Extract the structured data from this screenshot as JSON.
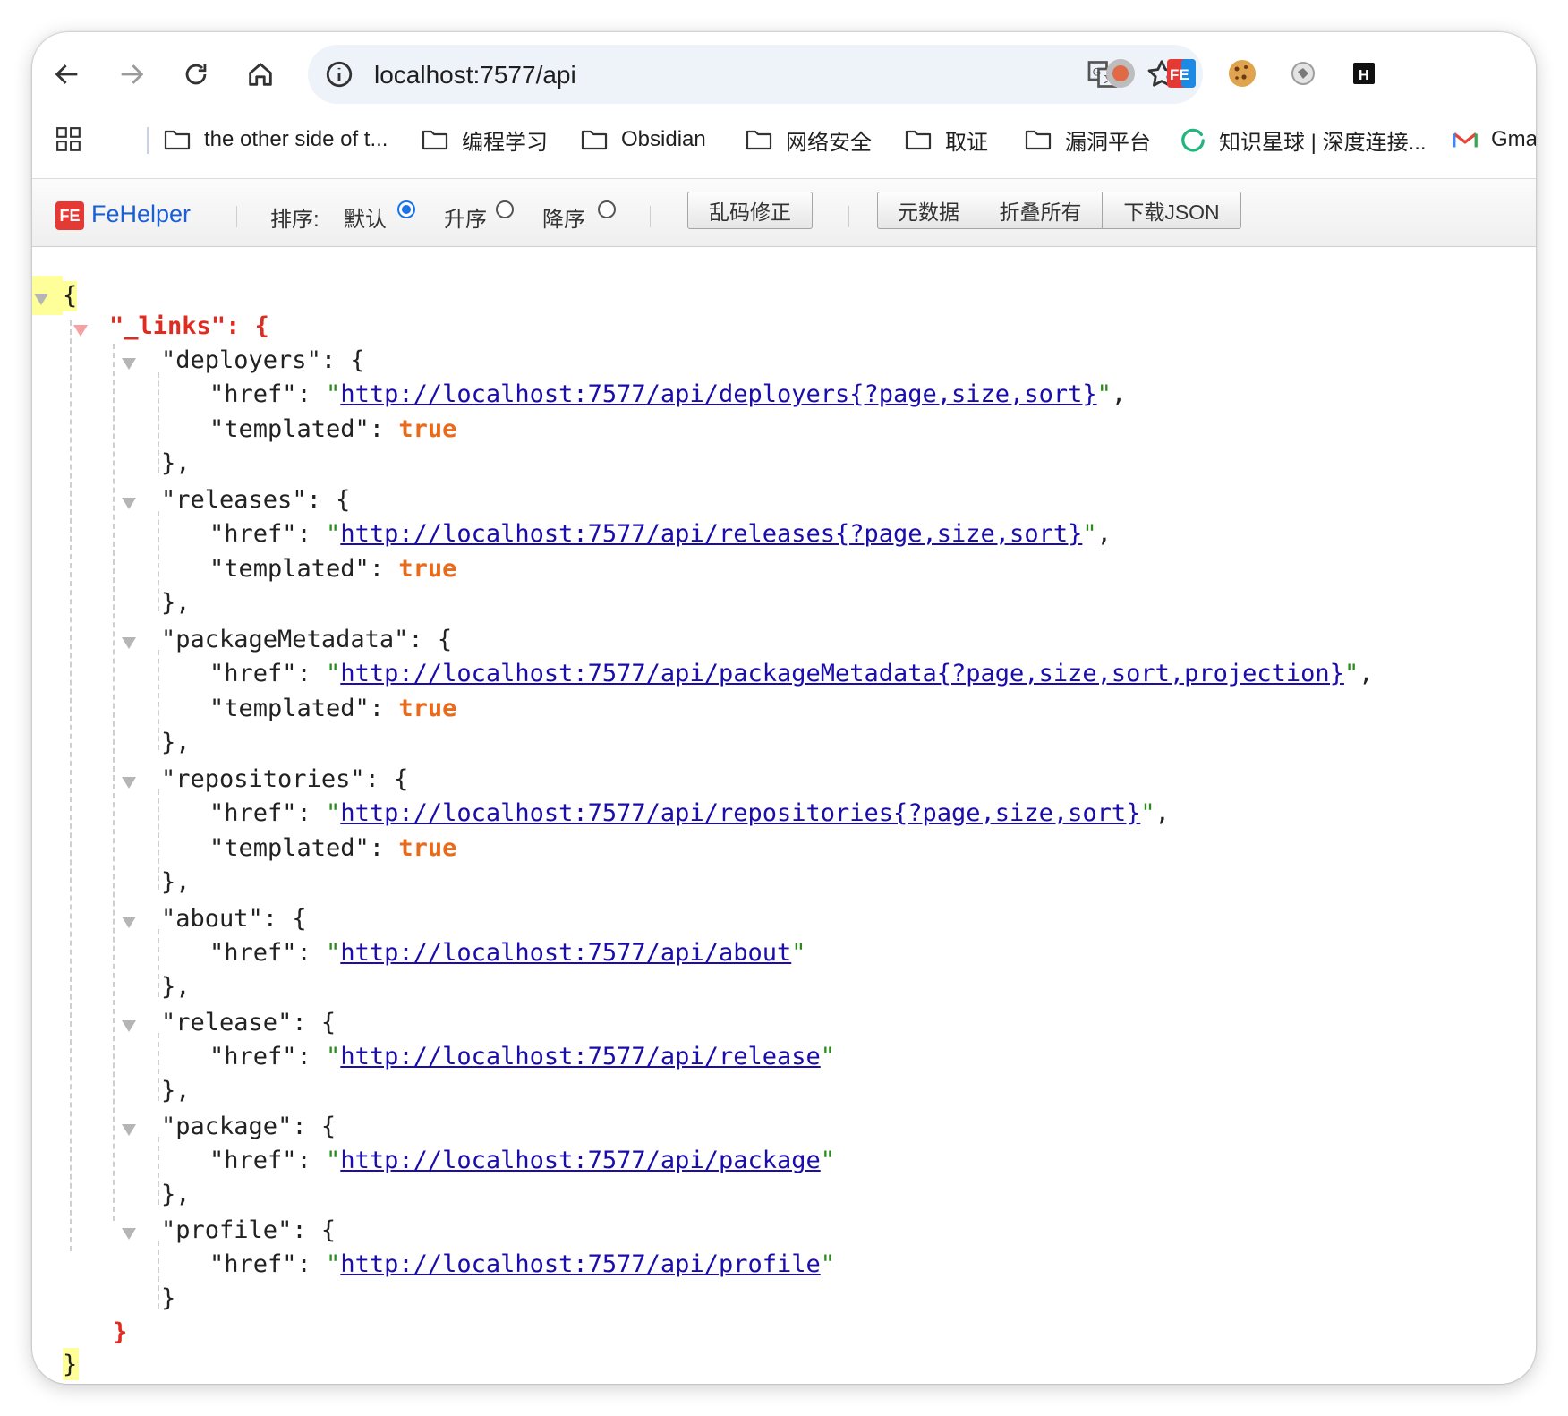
{
  "browser": {
    "url": "localhost:7577/api",
    "bookmarks": [
      {
        "label": "the other side of t...",
        "icon": "folder-icon"
      },
      {
        "label": "编程学习",
        "icon": "folder-icon"
      },
      {
        "label": "Obsidian",
        "icon": "folder-icon"
      },
      {
        "label": "网络安全",
        "icon": "folder-icon"
      },
      {
        "label": "取证",
        "icon": "folder-icon"
      },
      {
        "label": "漏洞平台",
        "icon": "folder-icon"
      },
      {
        "label": "知识星球 | 深度连接...",
        "icon": "zsxq-icon"
      },
      {
        "label": "Gma",
        "icon": "gmail-icon"
      }
    ],
    "extensions": [
      "record-icon",
      "fehelper-icon",
      "cookie-icon",
      "puzzle-icon",
      "h-icon"
    ]
  },
  "fehelper": {
    "title": "FeHelper",
    "logo": "FE",
    "sort_label": "排序:",
    "sort_options": [
      {
        "label": "默认",
        "checked": true
      },
      {
        "label": "升序",
        "checked": false
      },
      {
        "label": "降序",
        "checked": false
      }
    ],
    "fix_button": "乱码修正",
    "metadata_button": "元数据",
    "collapse_button": "折叠所有",
    "download_button": "下载JSON"
  },
  "json_view": {
    "root_key": "_links",
    "entries": [
      {
        "key": "deployers",
        "href": "http://localhost:7577/api/deployers{?page,size,sort}",
        "templated": "true"
      },
      {
        "key": "releases",
        "href": "http://localhost:7577/api/releases{?page,size,sort}",
        "templated": "true"
      },
      {
        "key": "packageMetadata",
        "href": "http://localhost:7577/api/packageMetadata{?page,size,sort,projection}",
        "templated": "true"
      },
      {
        "key": "repositories",
        "href": "http://localhost:7577/api/repositories{?page,size,sort}",
        "templated": "true"
      },
      {
        "key": "about",
        "href": "http://localhost:7577/api/about"
      },
      {
        "key": "release",
        "href": "http://localhost:7577/api/release"
      },
      {
        "key": "package",
        "href": "http://localhost:7577/api/package"
      },
      {
        "key": "profile",
        "href": "http://localhost:7577/api/profile"
      }
    ]
  },
  "colors": {
    "link": "#1a0dab",
    "bool": "#e86a1a",
    "root_key": "#e02b20",
    "string_quote": "#2b8a1d",
    "fehelper_title": "#1a5fd6"
  }
}
